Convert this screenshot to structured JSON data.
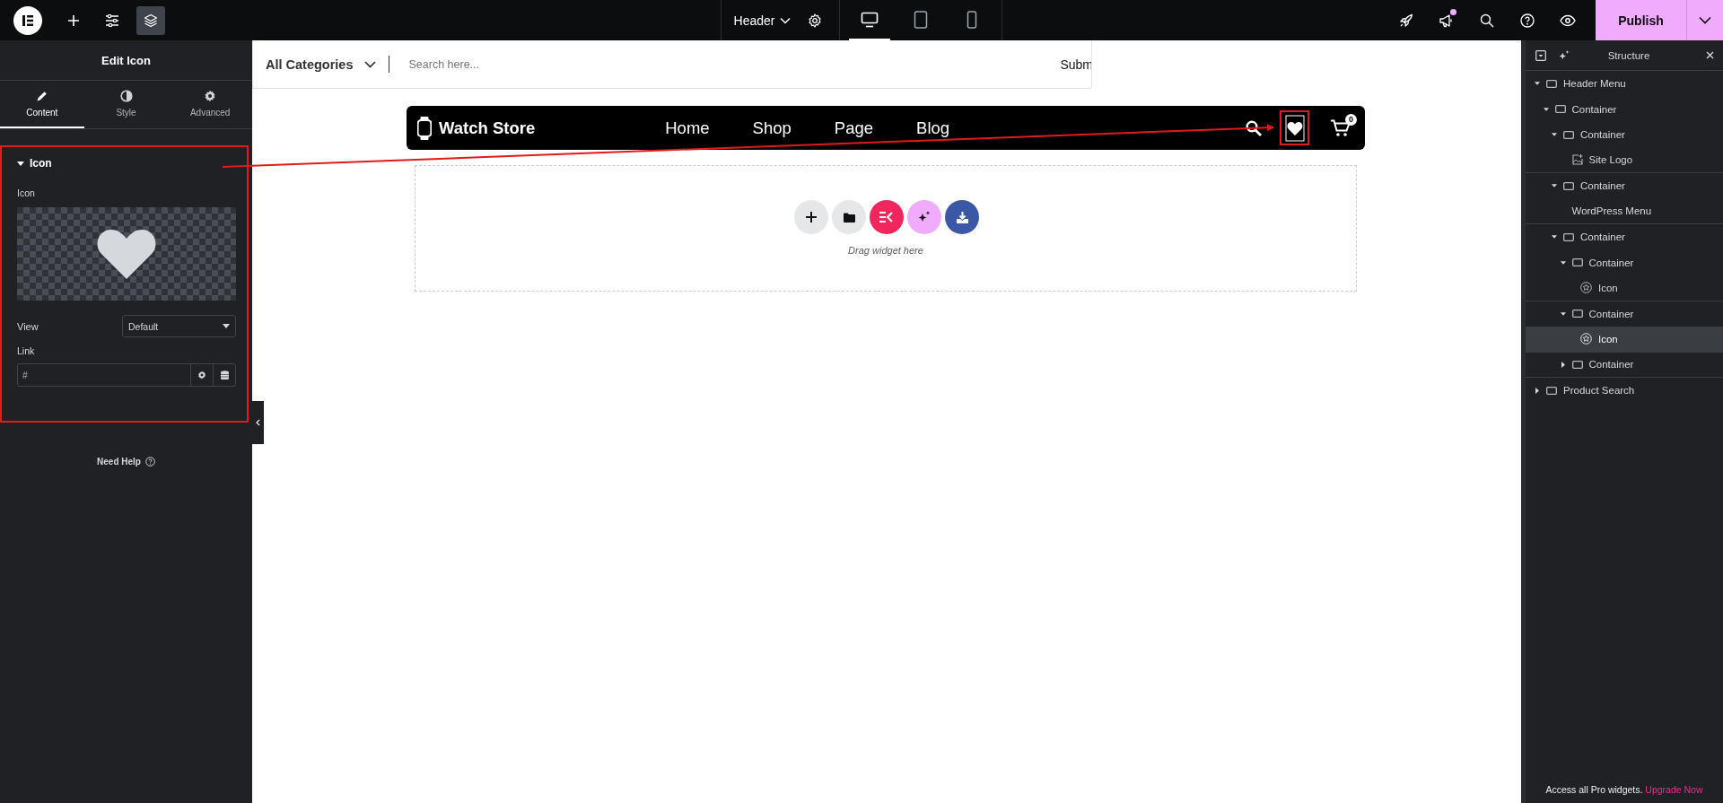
{
  "top_bar": {
    "document_name": "Header",
    "devices": [
      {
        "kind": "desktop",
        "selected": true
      },
      {
        "kind": "tablet",
        "selected": false
      },
      {
        "kind": "mobile",
        "selected": false
      }
    ],
    "notification_dot": true,
    "publish": "Publish"
  },
  "left_panel": {
    "title": "Edit Icon",
    "tabs": [
      {
        "label": "Content",
        "kind": "pencil",
        "selected": true
      },
      {
        "label": "Style",
        "kind": "contrast",
        "selected": false
      },
      {
        "label": "Advanced",
        "kind": "gear",
        "selected": false
      }
    ],
    "section": {
      "title": "Icon",
      "expanded": true,
      "icon_label": "Icon",
      "view_label": "View",
      "view_value": "Default",
      "link_label": "Link",
      "link_value": "#"
    },
    "help": "Need Help"
  },
  "canvas": {
    "search": {
      "category": "All Categories",
      "placeholder": "Search here...",
      "submit": "Subm"
    },
    "header": {
      "brand": "Watch Store",
      "menu": [
        "Home",
        "Shop",
        "Page",
        "Blog"
      ],
      "cart_count": "0"
    },
    "drop_zone": {
      "hint": "Drag widget here"
    }
  },
  "structure": {
    "title": "Structure",
    "tree": [
      {
        "label": "Header Menu",
        "kind": "container",
        "expanded": true,
        "selected": false,
        "children": [
          {
            "label": "Container",
            "kind": "container",
            "expanded": true,
            "selected": false,
            "children": [
              {
                "label": "Container",
                "kind": "container",
                "expanded": true,
                "selected": false,
                "children": [
                  {
                    "label": "Site Logo",
                    "kind": "image",
                    "selected": false
                  }
                ]
              },
              {
                "label": "Container",
                "kind": "container",
                "expanded": true,
                "selected": false,
                "children": [
                  {
                    "label": "WordPress Menu",
                    "kind": "plain",
                    "selected": false
                  }
                ]
              },
              {
                "label": "Container",
                "kind": "container",
                "expanded": true,
                "selected": false,
                "children": [
                  {
                    "label": "Container",
                    "kind": "container",
                    "expanded": true,
                    "selected": false,
                    "children": [
                      {
                        "label": "Icon",
                        "kind": "star",
                        "selected": false
                      }
                    ]
                  },
                  {
                    "label": "Container",
                    "kind": "container",
                    "expanded": true,
                    "selected": false,
                    "children": [
                      {
                        "label": "Icon",
                        "kind": "star",
                        "selected": true
                      }
                    ]
                  },
                  {
                    "label": "Container",
                    "kind": "container",
                    "expanded": false,
                    "selected": false
                  }
                ]
              }
            ]
          }
        ]
      },
      {
        "label": "Product Search",
        "kind": "container",
        "expanded": false,
        "selected": false
      }
    ]
  },
  "footer": {
    "text": "Access all Pro widgets.",
    "link": "Upgrade Now"
  }
}
